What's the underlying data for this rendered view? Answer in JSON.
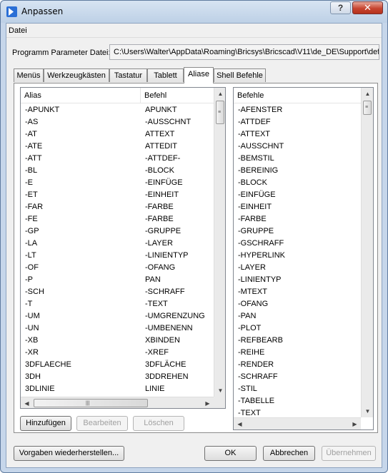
{
  "window": {
    "title": "Anpassen"
  },
  "titlebar": {
    "help_label": "?",
    "close_label": "✕"
  },
  "menu": {
    "file": "Datei"
  },
  "param": {
    "label": "Programm Parameter Datei:",
    "value": "C:\\Users\\Walter\\AppData\\Roaming\\Bricsys\\Bricscad\\V11\\de_DE\\Support\\def"
  },
  "tabs": [
    {
      "label": "Menüs"
    },
    {
      "label": "Werkzeugkästen"
    },
    {
      "label": "Tastatur"
    },
    {
      "label": "Tablett"
    },
    {
      "label": "Aliase"
    },
    {
      "label": "Shell Befehle"
    }
  ],
  "active_tab": "Aliase",
  "alias_list": {
    "columns": [
      "Alias",
      "Befehl"
    ],
    "rows": [
      [
        "-APUNKT",
        "APUNKT"
      ],
      [
        "-AS",
        "-AUSSCHNT"
      ],
      [
        "-AT",
        "ATTEXT"
      ],
      [
        "-ATE",
        "ATTEDIT"
      ],
      [
        "-ATT",
        "-ATTDEF-"
      ],
      [
        "-BL",
        "-BLOCK"
      ],
      [
        "-E",
        "-EINFÜGE"
      ],
      [
        "-ET",
        "-EINHEIT"
      ],
      [
        "-FAR",
        "-FARBE"
      ],
      [
        "-FE",
        "-FARBE"
      ],
      [
        "-GP",
        "-GRUPPE"
      ],
      [
        "-LA",
        "-LAYER"
      ],
      [
        "-LT",
        "-LINIENTYP"
      ],
      [
        "-OF",
        "-OFANG"
      ],
      [
        "-P",
        "PAN"
      ],
      [
        "-SCH",
        "-SCHRAFF"
      ],
      [
        "-T",
        "-TEXT"
      ],
      [
        "-UM",
        "-UMGRENZUNG"
      ],
      [
        "-UN",
        "-UMBENENN"
      ],
      [
        "-XB",
        "XBINDEN"
      ],
      [
        "-XR",
        "-XREF"
      ],
      [
        "3DFLAECHE",
        "3DFLÄCHE"
      ],
      [
        "3DH",
        "3DDREHEN"
      ],
      [
        "3DLINIE",
        "LINIE"
      ]
    ]
  },
  "commands_list": {
    "column": "Befehle",
    "rows": [
      "-AFENSTER",
      "-ATTDEF",
      "-ATTEXT",
      "-AUSSCHNT",
      "-BEMSTIL",
      "-BEREINIG",
      "-BLOCK",
      "-EINFÜGE",
      "-EINHEIT",
      "-FARBE",
      "-GRUPPE",
      "-GSCHRAFF",
      "-HYPERLINK",
      "-LAYER",
      "-LINIENTYP",
      "-MTEXT",
      "-OFANG",
      "-PAN",
      "-PLOT",
      "-REFBEARB",
      "-REIHE",
      "-RENDER",
      "-SCHRAFF",
      "-STIL",
      "-TABELLE",
      "-TEXT"
    ]
  },
  "scroll_glyphs": {
    "up": "▲",
    "down": "▼",
    "left": "◀",
    "right": "▶",
    "grip_v": "≡",
    "grip_h": "|||"
  },
  "list_buttons": {
    "add": "Hinzufügen",
    "edit": "Bearbeiten",
    "delete": "Löschen"
  },
  "footer": {
    "restore": "Vorgaben wiederherstellen...",
    "ok": "OK",
    "cancel": "Abbrechen",
    "apply": "Übernehmen"
  }
}
